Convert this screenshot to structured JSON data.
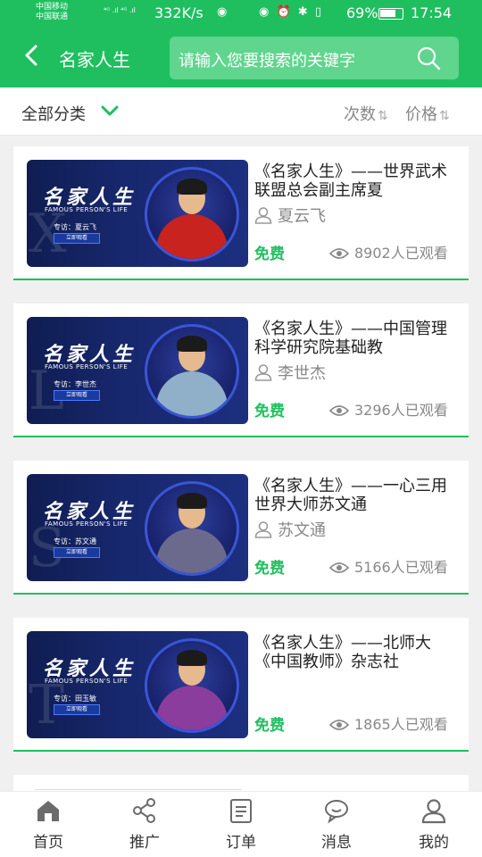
{
  "status_bar": {
    "carrier1": "中国移动",
    "carrier2": "中国联通",
    "network": "⁴ᴳ .ıl ⁴ᴳ .ıl",
    "speed": "332K/s",
    "battery": "69%",
    "time": "17:54"
  },
  "header": {
    "title": "名家人生",
    "search_placeholder": "请输入您要搜索的关键字"
  },
  "filter": {
    "category_label": "全部分类",
    "sort_count_label": "次数",
    "sort_price_label": "价格"
  },
  "colors": {
    "accent": "#1fbf5f",
    "card_bg": "#ffffff",
    "page_bg": "#f0f0f0"
  },
  "thumb_common": {
    "logo": "名家人生",
    "subtitle": "FAMOUS PERSON'S LIFE",
    "button": "立即观看"
  },
  "cards": [
    {
      "title": "《名家人生》——世界武术联盟总会副主席夏",
      "author": "夏云飞",
      "price": "免费",
      "views": "8902人已观看",
      "thumb_guest": "专访：夏云飞",
      "thumb_letter": "X",
      "outfit_color": "#c8231e"
    },
    {
      "title": "《名家人生》——中国管理科学研究院基础教",
      "author": "李世杰",
      "price": "免费",
      "views": "3296人已观看",
      "thumb_guest": "专访：李世杰",
      "thumb_letter": "L",
      "outfit_color": "#8fb0c8"
    },
    {
      "title": "《名家人生》——一心三用世界大师苏文通",
      "author": "苏文通",
      "price": "免费",
      "views": "5166人已观看",
      "thumb_guest": "专访：苏文通",
      "thumb_letter": "S",
      "outfit_color": "#6c6a8c"
    },
    {
      "title": "《名家人生》——北师大《中国教师》杂志社",
      "author": "",
      "price": "免费",
      "views": "1865人已观看",
      "thumb_guest": "专访：田玉敏",
      "thumb_letter": "T",
      "outfit_color": "#8a3d9c"
    }
  ],
  "nav": [
    {
      "label": "首页",
      "icon": "home-icon"
    },
    {
      "label": "推广",
      "icon": "share-icon"
    },
    {
      "label": "订单",
      "icon": "clipboard-icon"
    },
    {
      "label": "消息",
      "icon": "chat-bubble-icon"
    },
    {
      "label": "我的",
      "icon": "user-icon"
    }
  ]
}
